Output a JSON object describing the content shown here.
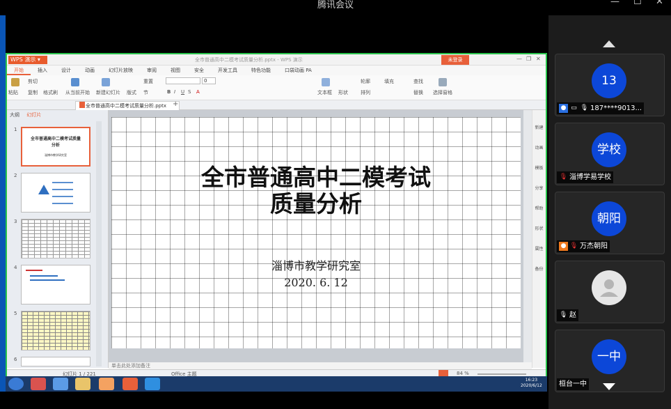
{
  "meeting": {
    "title": "腾讯会议"
  },
  "wps": {
    "app_label": "WPS 演示",
    "doc_title": "全市普通高中二模考试质量分析.pptx - WPS 演示",
    "login_button": "未登录",
    "menu": [
      "开始",
      "插入",
      "设计",
      "动画",
      "幻灯片放映",
      "审阅",
      "视图",
      "安全",
      "开发工具",
      "特色功能",
      "口袋动画 PA"
    ],
    "active_menu": "开始",
    "toolbar": {
      "paste": "粘贴",
      "cut": "剪切",
      "copy": "复制",
      "format_painter": "格式刷",
      "from_current": "从当前开始",
      "new_slide": "新建幻灯片",
      "layout": "版式",
      "section": "节",
      "reset": "重置",
      "font_size": "0",
      "textbox": "文本框",
      "shape": "形状",
      "arrange": "排列",
      "outline": "轮廓",
      "fill": "填充",
      "find": "查找",
      "replace": "替换",
      "select_pane": "选择窗格"
    },
    "doc_tab": "全市普通高中二模考试质量分析.pptx",
    "panel_tabs": [
      "大纲",
      "幻灯片"
    ],
    "panel_active": "幻灯片",
    "thumbnails": [
      {
        "num": "1",
        "title": "全市普通高中二模考试质量分析",
        "sub": "淄博市教学研究室"
      },
      {
        "num": "2"
      },
      {
        "num": "3"
      },
      {
        "num": "4"
      },
      {
        "num": "5"
      },
      {
        "num": "6"
      }
    ],
    "slide": {
      "title_line1": "全市普通高中二模考试",
      "title_line2": "质量分析",
      "org": "淄博市教学研究室",
      "date": "2020. 6. 12"
    },
    "notes_placeholder": "单击此处添加备注",
    "status": {
      "slide_count": "幻灯片 1 / 221",
      "theme": "Office 主题",
      "zoom": "84 %"
    },
    "sidetools": [
      "新建",
      "动画",
      "模板",
      "分享",
      "帮助",
      "形状",
      "属性",
      "备份"
    ]
  },
  "taskbar": {
    "clock_time": "16:23",
    "clock_date": "2020/6/12"
  },
  "participants": [
    {
      "avatar_text": "13",
      "name": "187****9013...",
      "avatar_color": "#0c47d8"
    },
    {
      "avatar_text": "学校",
      "name": "淄博学易学校",
      "avatar_color": "#0c47d8"
    },
    {
      "avatar_text": "朝阳",
      "name": "万杰朝阳",
      "avatar_color": "#0c47d8"
    },
    {
      "avatar_text": "",
      "name": "赵",
      "avatar_color": "#e6e6e6"
    },
    {
      "avatar_text": "一中",
      "name": "桓台一中",
      "avatar_color": "#0c47d8"
    }
  ],
  "colors": {
    "accent": "#e8603a",
    "share_border": "#29c34b",
    "avatar_blue": "#0c47d8"
  }
}
